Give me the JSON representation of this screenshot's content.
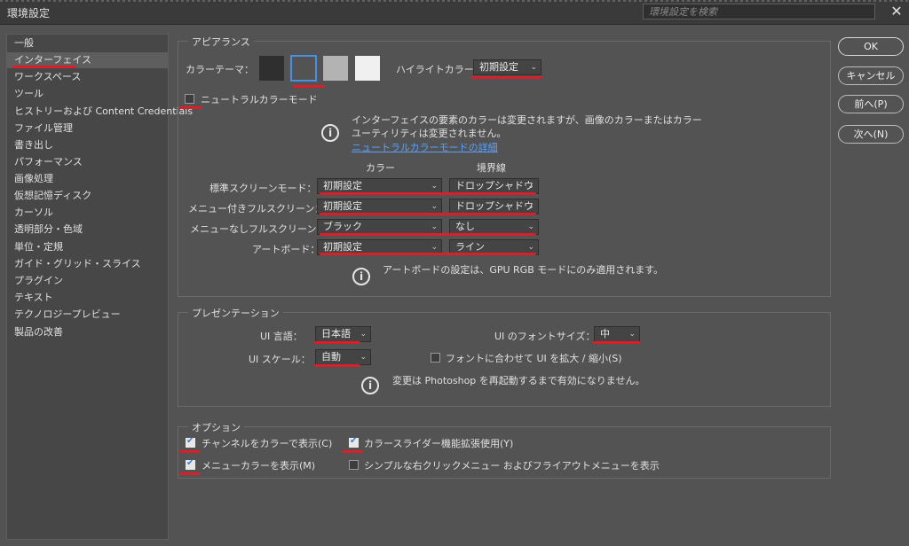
{
  "window": {
    "title": "環境設定",
    "search_placeholder": "環境設定を検索",
    "close": "✕"
  },
  "sidebar": {
    "items": [
      {
        "label": "一般"
      },
      {
        "label": "インターフェイス"
      },
      {
        "label": "ワークスペース"
      },
      {
        "label": "ツール"
      },
      {
        "label": "ヒストリーおよび Content Credentials"
      },
      {
        "label": "ファイル管理"
      },
      {
        "label": "書き出し"
      },
      {
        "label": "パフォーマンス"
      },
      {
        "label": "画像処理"
      },
      {
        "label": "仮想記憶ディスク"
      },
      {
        "label": "カーソル"
      },
      {
        "label": "透明部分・色域"
      },
      {
        "label": "単位・定規"
      },
      {
        "label": "ガイド・グリッド・スライス"
      },
      {
        "label": "プラグイン"
      },
      {
        "label": "テキスト"
      },
      {
        "label": "テクノロジープレビュー"
      },
      {
        "label": "製品の改善"
      }
    ],
    "selected": "インターフェイス"
  },
  "appearance": {
    "legend": "アピアランス",
    "color_theme_label": "カラーテーマ：",
    "swatches": [
      "#2f2f2f",
      "#535353",
      "#b3b3b3",
      "#f0f0f0"
    ],
    "highlight_label": "ハイライトカラー：",
    "highlight_value": "初期設定",
    "neutral_mode_label": "ニュートラルカラーモード",
    "neutral_info_line1": "インターフェイスの要素のカラーは変更されますが、画像のカラーまたはカラー",
    "neutral_info_line2": "ユーティリティは変更されません。",
    "neutral_link": "ニュートラルカラーモードの詳細",
    "col_color": "カラー",
    "col_border": "境界線",
    "rows": [
      {
        "label": "標準スクリーンモード：",
        "color": "初期設定",
        "border": "ドロップシャドウ"
      },
      {
        "label": "メニュー付きフルスクリーン：",
        "color": "初期設定",
        "border": "ドロップシャドウ"
      },
      {
        "label": "メニューなしフルスクリーン：",
        "color": "ブラック",
        "border": "なし"
      },
      {
        "label": "アートボード：",
        "color": "初期設定",
        "border": "ライン"
      }
    ],
    "artboard_info": "アートボードの設定は、GPU RGB モードにのみ適用されます。"
  },
  "presentation": {
    "legend": "プレゼンテーション",
    "ui_lang_label": "UI 言語：",
    "ui_lang_value": "日本語",
    "ui_font_label": "UI のフォントサイズ：",
    "ui_font_value": "中",
    "ui_scale_label": "UI スケール：",
    "ui_scale_value": "自動",
    "scale_to_font_label": "フォントに合わせて UI を拡大 / 縮小(S)",
    "restart_info": "変更は Photoshop を再起動するまで有効になりません。"
  },
  "options": {
    "legend": "オプション",
    "show_channels": "チャンネルをカラーで表示(C)",
    "color_slider": "カラースライダー機能拡張使用(Y)",
    "menu_colors": "メニューカラーを表示(M)",
    "simple_menu": "シンプルな右クリックメニュー およびフライアウトメニューを表示"
  },
  "buttons": {
    "ok": "OK",
    "cancel": "キャンセル",
    "prev": "前へ(P)",
    "next": "次へ(N)"
  },
  "colors": {
    "highlight_red": "#d81f2a",
    "check_blue": "#3a7bd5",
    "link": "#5aa0ff"
  }
}
